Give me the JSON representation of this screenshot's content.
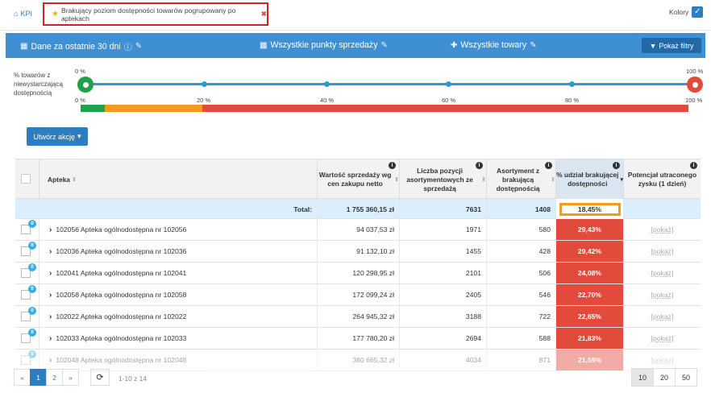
{
  "nav": {
    "kpi_label": "KPI",
    "active_tab": "Brakujący poziom dostępności towarów pogrupowany po aptekach"
  },
  "kolory": {
    "label": "Kolory"
  },
  "filters": {
    "period": "Dane za ostatnie 30 dni",
    "points": "Wszystkie punkty sprzedaży",
    "products": "Wszystkie towary",
    "show_filters": "Pokaż filtry"
  },
  "slider": {
    "label": "% towarów z niewystarczającą dostępnością",
    "min_label": "0 %",
    "max_label": "100 %",
    "ticks": [
      "0 %",
      "20 %",
      "40 %",
      "60 %",
      "80 %",
      "100 %"
    ]
  },
  "action_button": "Utwórz akcję",
  "table": {
    "headers": {
      "pharmacy": "Apteka",
      "sales": "Wartość sprzedaży wg cen zakupu netto",
      "positions": "Liczba pozycji asortymentowych ze sprzedażą",
      "missing": "Asortyment z brakującą dostępnością",
      "share": "% udział brakującej dostępności",
      "potential": "Potencjał utraconego zysku (1 dzień)"
    },
    "total": {
      "label": "Total:",
      "sales": "1 755 360,15 zł",
      "positions": "7631",
      "missing": "1408",
      "share": "18,45%"
    },
    "rows": [
      {
        "badge": "0",
        "name": "102056 Apteka ogólnodostępna nr 102056",
        "sales": "94 037,53 zł",
        "positions": "1971",
        "missing": "580",
        "share": "29,43%",
        "potential": "[pokaż]"
      },
      {
        "badge": "0",
        "name": "102036 Apteka ogólnodostępna nr 102036",
        "sales": "91 132,10 zł",
        "positions": "1455",
        "missing": "428",
        "share": "29,42%",
        "potential": "[pokaż]"
      },
      {
        "badge": "0",
        "name": "102041 Apteka ogólnodostępna nr 102041",
        "sales": "120 298,95 zł",
        "positions": "2101",
        "missing": "506",
        "share": "24,08%",
        "potential": "[pokaż]"
      },
      {
        "badge": "0",
        "name": "102058 Apteka ogólnodostępna nr 102058",
        "sales": "172 099,24 zł",
        "positions": "2405",
        "missing": "546",
        "share": "22,70%",
        "potential": "[pokaż]"
      },
      {
        "badge": "0",
        "name": "102022 Apteka ogólnodostępna nr 102022",
        "sales": "264 945,32 zł",
        "positions": "3188",
        "missing": "722",
        "share": "22,65%",
        "potential": "[pokaż]"
      },
      {
        "badge": "0",
        "name": "102033 Apteka ogólnodostępna nr 102033",
        "sales": "177 780,20 zł",
        "positions": "2694",
        "missing": "588",
        "share": "21,83%",
        "potential": "[pokaż]"
      },
      {
        "badge": "0",
        "name": "102048 Apteka ogólnodostępna nr 102048",
        "sales": "380 665,32 zł",
        "positions": "4034",
        "missing": "871",
        "share": "21,59%",
        "potential": "[pokaż]"
      }
    ]
  },
  "pagination": {
    "prev": "«",
    "pages": [
      "1",
      "2"
    ],
    "next": "»",
    "range": "1-10 z 14",
    "sizes": [
      "10",
      "20",
      "50"
    ]
  },
  "colors": {
    "accent": "#2e7ebf",
    "bar": "#3f8fd3",
    "red": "#e24a3c",
    "green": "#22a04a",
    "orange": "#f29b1f"
  }
}
